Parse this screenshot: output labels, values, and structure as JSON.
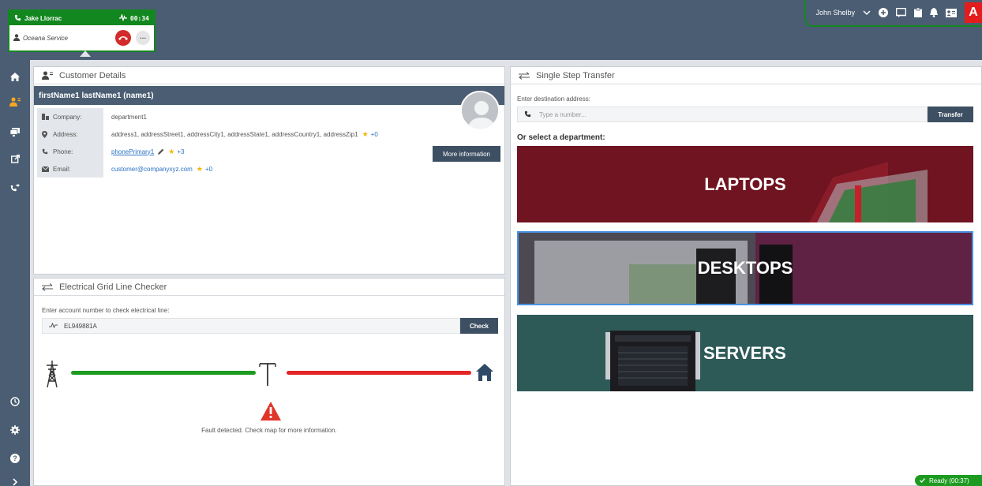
{
  "call": {
    "caller": "Jake Llorrac",
    "timer": "00:34",
    "service": "Oceana Service"
  },
  "header": {
    "user": "John Shelby"
  },
  "customer_panel": {
    "title": "Customer Details",
    "customer_name": "firstName1 lastName1 (name1)",
    "fields": [
      {
        "label": "Company:",
        "value": "department1"
      },
      {
        "label": "Address:",
        "value": "address1, addressStreet1, addressCity1, addressState1, addressCountry1, addressZip1",
        "extra": "+0"
      },
      {
        "label": "Phone:",
        "value": "phonePrimary1",
        "extra": "+3"
      },
      {
        "label": "Email:",
        "value": "customer@companyxyz.com",
        "extra": "+0"
      }
    ],
    "more_info_label": "More information"
  },
  "grid_panel": {
    "title": "Electrical Grid Line Checker",
    "prompt": "Enter account number to check electrical line:",
    "account_value": "EL949881A",
    "check_label": "Check",
    "fault_message": "Fault detected. Check map for more information."
  },
  "transfer_panel": {
    "title": "Single Step Transfer",
    "prompt": "Enter destination address:",
    "placeholder": "Type a number...",
    "transfer_label": "Transfer",
    "dept_prompt": "Or select a department:",
    "departments": [
      {
        "label": "LAPTOPS"
      },
      {
        "label": "DESKTOPS"
      },
      {
        "label": "SERVERS"
      }
    ]
  },
  "status": {
    "ready_label": "Ready (00:37)"
  },
  "colors": {
    "nav_bg": "#4a5d72",
    "call_green": "#13871f",
    "line_ok": "#1d9b21",
    "line_fault": "#e42525",
    "accent_orange": "#f5a623"
  }
}
